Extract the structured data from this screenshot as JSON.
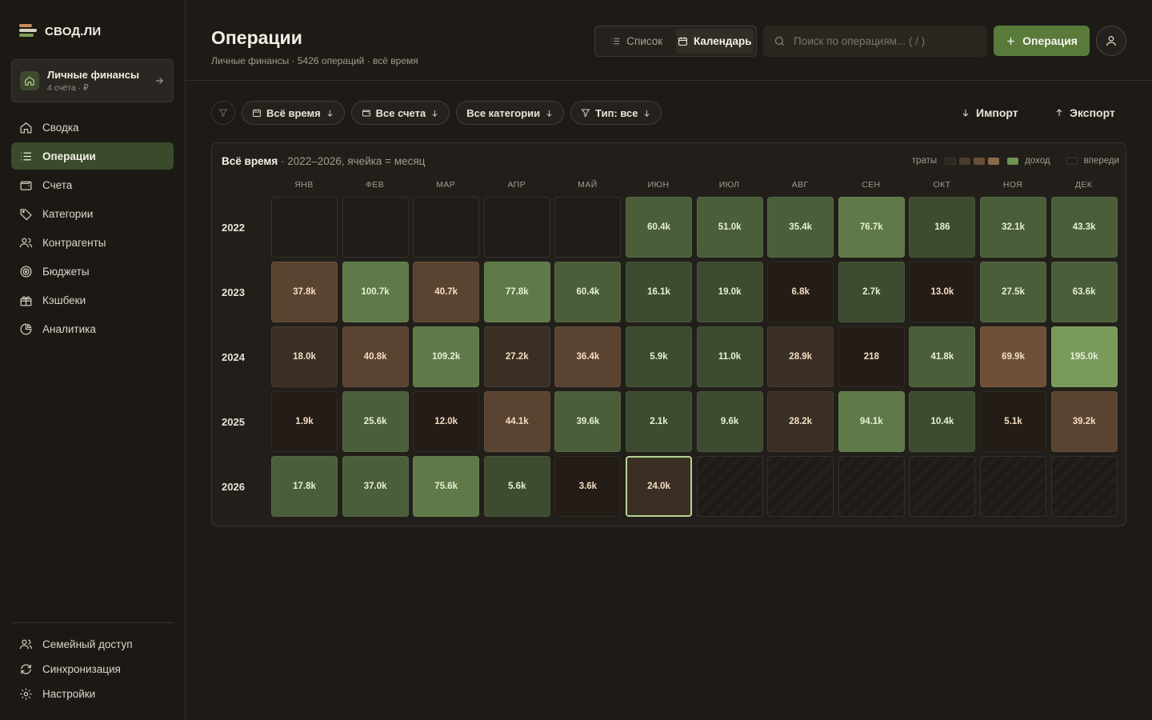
{
  "app": {
    "name": "СВОД.ЛИ"
  },
  "account_switcher": {
    "name": "Личные финансы",
    "sub": "4 счёта · ₽"
  },
  "nav": [
    {
      "label": "Сводка",
      "icon": "home-icon",
      "active": false
    },
    {
      "label": "Операции",
      "icon": "list-icon",
      "active": true
    },
    {
      "label": "Счета",
      "icon": "wallet-icon",
      "active": false
    },
    {
      "label": "Категории",
      "icon": "tag-icon",
      "active": false
    },
    {
      "label": "Контрагенты",
      "icon": "users-icon",
      "active": false
    },
    {
      "label": "Бюджеты",
      "icon": "target-icon",
      "active": false
    },
    {
      "label": "Кэшбеки",
      "icon": "gift-icon",
      "active": false
    },
    {
      "label": "Аналитика",
      "icon": "pie-chart-icon",
      "active": false
    }
  ],
  "nav_bottom": [
    {
      "label": "Семейный доступ",
      "icon": "users-icon"
    },
    {
      "label": "Синхронизация",
      "icon": "refresh-icon"
    },
    {
      "label": "Настройки",
      "icon": "gear-icon"
    }
  ],
  "header": {
    "title": "Операции",
    "subtitle": "Личные финансы · 5426 операций · всё время",
    "view_list": "Список",
    "view_calendar": "Календарь",
    "search_placeholder": "Поиск по операциям... ( / )",
    "add_label": "Операция"
  },
  "filters": {
    "period": "Всё время",
    "accounts": "Все счета",
    "categories": "Все категории",
    "type": "Тип: все",
    "import": "Импорт",
    "export": "Экспорт"
  },
  "calendar": {
    "title": "Всё время",
    "subtitle": " · 2022–2026, ячейка = месяц",
    "legend": {
      "spend": "траты",
      "income": "доход",
      "ahead": "впереди"
    },
    "colors": {
      "income": "#5a7a3c",
      "spend": "#8b6a4a",
      "current_border": "#b5d38f"
    },
    "months": [
      "ЯНВ",
      "ФЕВ",
      "МАР",
      "АПР",
      "МАЙ",
      "ИЮН",
      "ИЮЛ",
      "АВГ",
      "СЕН",
      "ОКТ",
      "НОЯ",
      "ДЕК"
    ],
    "years": [
      {
        "year": "2022",
        "cells": [
          {
            "state": "empty"
          },
          {
            "state": "empty"
          },
          {
            "state": "empty"
          },
          {
            "state": "empty"
          },
          {
            "state": "empty"
          },
          {
            "value": "60.4k",
            "kind": "income",
            "level": 2
          },
          {
            "value": "51.0k",
            "kind": "income",
            "level": 2
          },
          {
            "value": "35.4k",
            "kind": "income",
            "level": 2
          },
          {
            "value": "76.7k",
            "kind": "income",
            "level": 3
          },
          {
            "value": "186",
            "kind": "income",
            "level": 1
          },
          {
            "value": "32.1k",
            "kind": "income",
            "level": 2
          },
          {
            "value": "43.3k",
            "kind": "income",
            "level": 2
          }
        ]
      },
      {
        "year": "2023",
        "cells": [
          {
            "value": "37.8k",
            "kind": "spend",
            "level": 2
          },
          {
            "value": "100.7k",
            "kind": "income",
            "level": 3
          },
          {
            "value": "40.7k",
            "kind": "spend",
            "level": 2
          },
          {
            "value": "77.8k",
            "kind": "income",
            "level": 3
          },
          {
            "value": "60.4k",
            "kind": "income",
            "level": 2
          },
          {
            "value": "16.1k",
            "kind": "income",
            "level": 1
          },
          {
            "value": "19.0k",
            "kind": "income",
            "level": 1
          },
          {
            "value": "6.8k",
            "kind": "spend",
            "level": 0
          },
          {
            "value": "2.7k",
            "kind": "income",
            "level": 1
          },
          {
            "value": "13.0k",
            "kind": "spend",
            "level": 0
          },
          {
            "value": "27.5k",
            "kind": "income",
            "level": 2
          },
          {
            "value": "63.6k",
            "kind": "income",
            "level": 2
          }
        ]
      },
      {
        "year": "2024",
        "cells": [
          {
            "value": "18.0k",
            "kind": "spend",
            "level": 1
          },
          {
            "value": "40.8k",
            "kind": "spend",
            "level": 2
          },
          {
            "value": "109.2k",
            "kind": "income",
            "level": 3
          },
          {
            "value": "27.2k",
            "kind": "spend",
            "level": 1
          },
          {
            "value": "36.4k",
            "kind": "spend",
            "level": 2
          },
          {
            "value": "5.9k",
            "kind": "income",
            "level": 1
          },
          {
            "value": "11.0k",
            "kind": "income",
            "level": 1
          },
          {
            "value": "28.9k",
            "kind": "spend",
            "level": 1
          },
          {
            "value": "218",
            "kind": "spend",
            "level": 0
          },
          {
            "value": "41.8k",
            "kind": "income",
            "level": 2
          },
          {
            "value": "69.9k",
            "kind": "spend",
            "level": 3
          },
          {
            "value": "195.0k",
            "kind": "income",
            "level": 4
          }
        ]
      },
      {
        "year": "2025",
        "cells": [
          {
            "value": "1.9k",
            "kind": "spend",
            "level": 0
          },
          {
            "value": "25.6k",
            "kind": "income",
            "level": 2
          },
          {
            "value": "12.0k",
            "kind": "spend",
            "level": 0
          },
          {
            "value": "44.1k",
            "kind": "spend",
            "level": 2
          },
          {
            "value": "39.6k",
            "kind": "income",
            "level": 2
          },
          {
            "value": "2.1k",
            "kind": "income",
            "level": 1
          },
          {
            "value": "9.6k",
            "kind": "income",
            "level": 1
          },
          {
            "value": "28.2k",
            "kind": "spend",
            "level": 1
          },
          {
            "value": "94.1k",
            "kind": "income",
            "level": 3
          },
          {
            "value": "10.4k",
            "kind": "income",
            "level": 1
          },
          {
            "value": "5.1k",
            "kind": "spend",
            "level": 0
          },
          {
            "value": "39.2k",
            "kind": "spend",
            "level": 2
          }
        ]
      },
      {
        "year": "2026",
        "cells": [
          {
            "value": "17.8k",
            "kind": "income",
            "level": 2
          },
          {
            "value": "37.0k",
            "kind": "income",
            "level": 2
          },
          {
            "value": "75.6k",
            "kind": "income",
            "level": 3
          },
          {
            "value": "5.6k",
            "kind": "income",
            "level": 1
          },
          {
            "value": "3.6k",
            "kind": "spend",
            "level": 0
          },
          {
            "value": "24.0k",
            "kind": "spend",
            "level": 1,
            "current": true
          },
          {
            "state": "future"
          },
          {
            "state": "future"
          },
          {
            "state": "future"
          },
          {
            "state": "future"
          },
          {
            "state": "future"
          },
          {
            "state": "future"
          }
        ]
      }
    ]
  }
}
